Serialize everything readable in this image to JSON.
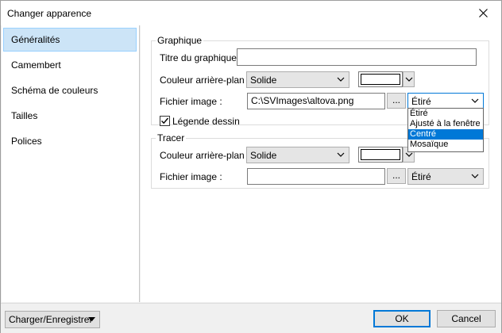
{
  "window": {
    "title": "Changer apparence",
    "close_icon": "close-icon"
  },
  "sidebar": {
    "items": [
      {
        "label": "Généralités",
        "selected": true
      },
      {
        "label": "Camembert"
      },
      {
        "label": "Schéma de couleurs"
      },
      {
        "label": "Tailles"
      },
      {
        "label": "Polices"
      }
    ]
  },
  "graphique": {
    "group_title": "Graphique",
    "title_label": "Titre du graphique :",
    "title_value": "",
    "bg_label": "Couleur arrière-plan :",
    "bg_value": "Solide",
    "bg_color": "#ffffff",
    "image_label": "Fichier image :",
    "image_value": "C:\\SVImages\\altova.png",
    "browse_label": "...",
    "stretch_value": "Étiré",
    "legend_label": "Légende dessin",
    "legend_checked": true
  },
  "tracer": {
    "group_title": "Tracer",
    "bg_label": "Couleur arrière-plan :",
    "bg_value": "Solide",
    "bg_color": "#ffffff",
    "image_label": "Fichier image :",
    "image_value": "",
    "browse_label": "...",
    "stretch_value": "Étiré"
  },
  "dropdown": {
    "options": [
      "Étiré",
      "Ajusté à la fenêtre",
      "Centré",
      "Mosaïque"
    ],
    "highlighted": "Centré"
  },
  "footer": {
    "load_save_label": "Charger/Enregistrer",
    "ok_label": "OK",
    "cancel_label": "Cancel"
  },
  "colors": {
    "accent": "#0078d7",
    "selection_bg": "#cce4f7"
  }
}
